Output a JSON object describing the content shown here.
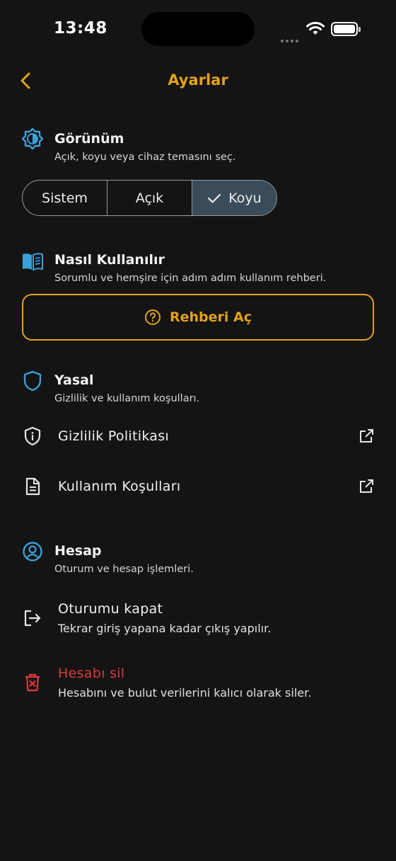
{
  "status_bar": {
    "time": "13:48"
  },
  "header": {
    "title": "Ayarlar"
  },
  "appearance": {
    "title": "Görünüm",
    "subtitle": "Açık, koyu veya cihaz temasını seç.",
    "options": [
      "Sistem",
      "Açık",
      "Koyu"
    ],
    "selected": "Koyu"
  },
  "howto": {
    "title": "Nasıl Kullanılır",
    "subtitle": "Sorumlu ve hemşire için adım adım kullanım rehberi.",
    "button_label": "Rehberi Aç"
  },
  "legal": {
    "title": "Yasal",
    "subtitle": "Gizlilik ve kullanım koşulları.",
    "items": [
      "Gizlilik Politikası",
      "Kullanım Koşulları"
    ]
  },
  "account": {
    "title": "Hesap",
    "subtitle": "Oturum ve hesap işlemleri.",
    "logout": {
      "label": "Oturumu kapat",
      "description": "Tekrar giriş yapana kadar çıkış yapılır."
    },
    "delete": {
      "label": "Hesabı sil",
      "description": "Hesabını ve bulut verilerini kalıcı olarak siler."
    }
  },
  "colors": {
    "accent": "#E3A21A",
    "section_icon": "#3AA0D8",
    "danger": "#E0383A",
    "background": "#141414"
  },
  "icons": {
    "back": "chevron-left-icon",
    "appearance": "brightness-icon",
    "howto": "book-icon",
    "legal": "shield-icon",
    "privacy": "info-shield-icon",
    "terms": "document-icon",
    "external": "external-link-icon",
    "account": "user-circle-icon",
    "logout": "logout-icon",
    "delete": "trash-icon",
    "help": "help-circle-icon",
    "check": "check-icon"
  }
}
